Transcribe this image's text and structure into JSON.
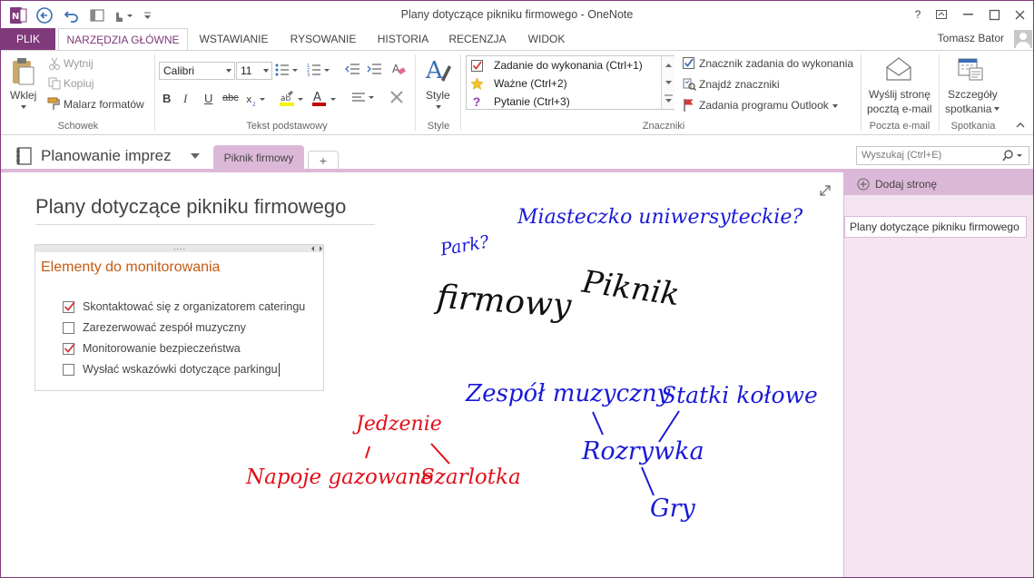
{
  "window": {
    "title": "Plany dotyczące pikniku firmowego - OneNote",
    "user": "Tomasz Bator",
    "help": "?"
  },
  "tabs": {
    "file": "PLIK",
    "items": [
      "NARZĘDZIA GŁÓWNE",
      "WSTAWIANIE",
      "RYSOWANIE",
      "HISTORIA",
      "RECENZJA",
      "WIDOK"
    ],
    "active_index": 0
  },
  "ribbon": {
    "clipboard": {
      "paste": "Wklej",
      "cut": "Wytnij",
      "copy": "Kopiuj",
      "format_painter": "Malarz formatów",
      "group": "Schowek"
    },
    "basic_text": {
      "font": "Calibri",
      "size": "11",
      "group": "Tekst podstawowy"
    },
    "styles": {
      "label": "Style",
      "group": "Style"
    },
    "tags": {
      "items": [
        "Zadanie do wykonania (Ctrl+1)",
        "Ważne (Ctrl+2)",
        "Pytanie (Ctrl+3)"
      ],
      "todo_tag": "Znacznik zadania do wykonania",
      "find_tags": "Znajdź znaczniki",
      "outlook_tasks": "Zadania programu Outlook",
      "group": "Znaczniki"
    },
    "email": {
      "label1": "Wyślij stronę",
      "label2": "pocztą e-mail",
      "group": "Poczta e-mail"
    },
    "meetings": {
      "label1": "Szczegóły",
      "label2": "spotkania",
      "group": "Spotkania"
    }
  },
  "notebook": {
    "name": "Planowanie imprez",
    "section": "Piknik firmowy",
    "add_section": "+",
    "search_placeholder": "Wyszukaj (Ctrl+E)"
  },
  "page": {
    "title": "Plany dotyczące pikniku firmowego",
    "outline_handle": "....",
    "outline_heading": "Elementy do monitorowania",
    "todos": [
      {
        "text": "Skontaktować się z organizatorem cateringu",
        "checked": true
      },
      {
        "text": "Zarezerwować zespół muzyczny",
        "checked": false
      },
      {
        "text": "Monitorowanie bezpieczeństwa",
        "checked": true
      },
      {
        "text": "Wysłać wskazówki dotyczące parkingu",
        "checked": false
      }
    ],
    "ink": {
      "campus": "Miasteczko uniwersyteckie?",
      "park": "Park?",
      "firmowy": "firmowy",
      "piknik": "Piknik",
      "band": "Zespół muzyczny",
      "boats": "Statki kołowe",
      "entertainment": "Rozrywka",
      "games": "Gry",
      "food": "Jedzenie",
      "sodas": "Napoje gazowane",
      "pie": "Szarlotka"
    },
    "ink_colors": {
      "blue": "#1a1ad6",
      "black": "#111111",
      "red": "#e0101a"
    }
  },
  "pages_pane": {
    "add_page": "Dodaj stronę",
    "pages": [
      "Plany dotyczące pikniku firmowego"
    ]
  },
  "colors": {
    "accent": "#80397b",
    "section_tab": "#dcb8d8",
    "page_pane": "#f4e4f1",
    "heading": "#c55a11"
  }
}
